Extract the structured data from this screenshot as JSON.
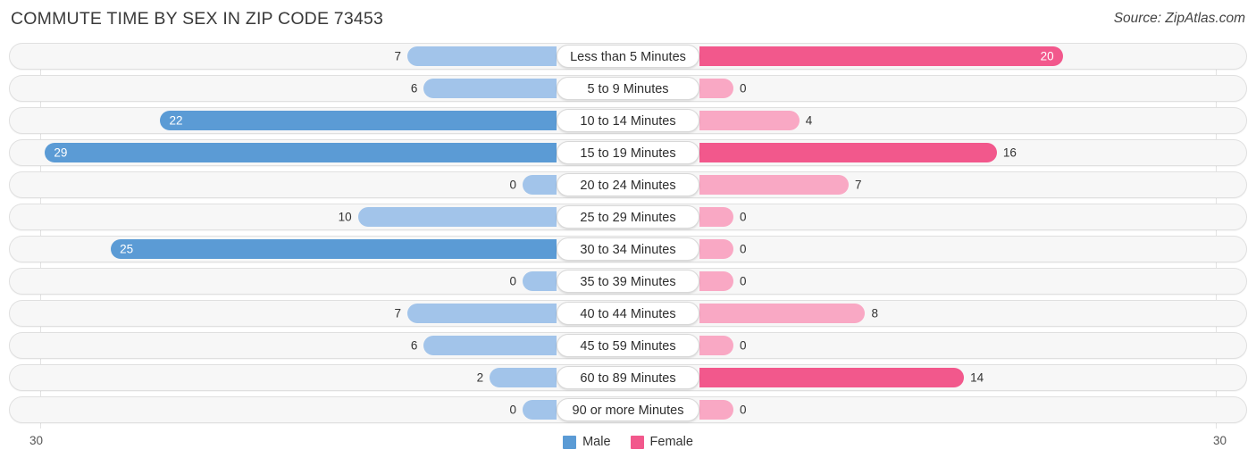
{
  "header": {
    "title": "COMMUTE TIME BY SEX IN ZIP CODE 73453",
    "source": "Source: ZipAtlas.com"
  },
  "axis": {
    "left_max_label": "30",
    "right_max_label": "30"
  },
  "legend": {
    "items": [
      {
        "label": "Male",
        "color": "#5b9bd5"
      },
      {
        "label": "Female",
        "color": "#f2588c"
      }
    ]
  },
  "colors": {
    "male_light": "#a2c4ea",
    "male_dark": "#5b9bd5",
    "female_light": "#f9a8c4",
    "female_dark": "#f2588c",
    "track": "#f7f7f7",
    "track_border": "#e0e0e0"
  },
  "chart_data": {
    "type": "bar",
    "title": "COMMUTE TIME BY SEX IN ZIP CODE 73453",
    "subtitle": "",
    "orientation": "horizontal-diverging",
    "xlabel": "",
    "ylabel": "",
    "xlim": [
      30,
      30
    ],
    "grid": false,
    "legend_position": "bottom-center",
    "categories": [
      "Less than 5 Minutes",
      "5 to 9 Minutes",
      "10 to 14 Minutes",
      "15 to 19 Minutes",
      "20 to 24 Minutes",
      "25 to 29 Minutes",
      "30 to 34 Minutes",
      "35 to 39 Minutes",
      "40 to 44 Minutes",
      "45 to 59 Minutes",
      "60 to 89 Minutes",
      "90 or more Minutes"
    ],
    "series": [
      {
        "name": "Male",
        "side": "left",
        "values": [
          7,
          6,
          22,
          29,
          0,
          10,
          25,
          0,
          7,
          6,
          2,
          0
        ]
      },
      {
        "name": "Female",
        "side": "right",
        "values": [
          20,
          0,
          4,
          16,
          7,
          0,
          0,
          0,
          8,
          0,
          14,
          0
        ]
      }
    ]
  }
}
